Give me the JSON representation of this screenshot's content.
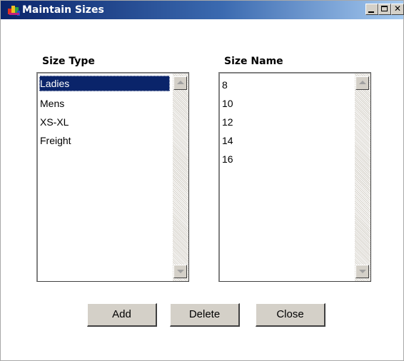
{
  "window": {
    "title": "Maintain Sizes",
    "icon": "app-logo-icon"
  },
  "title_buttons": {
    "minimize": "minimize-icon",
    "maximize": "maximize-icon",
    "close": "close-icon"
  },
  "size_type": {
    "label": "Size Type",
    "items": [
      "Ladies",
      "Mens",
      "XS-XL",
      "Freight"
    ],
    "selected": "Ladies"
  },
  "size_name": {
    "label": "Size Name",
    "items": [
      "8",
      "10",
      "12",
      "14",
      "16"
    ]
  },
  "buttons": {
    "add": "Add",
    "delete": "Delete",
    "close": "Close"
  },
  "colors": {
    "title_start": "#0a246a",
    "title_end": "#a6caf0",
    "selection": "#0a246a",
    "button_face": "#d4d0c8"
  }
}
